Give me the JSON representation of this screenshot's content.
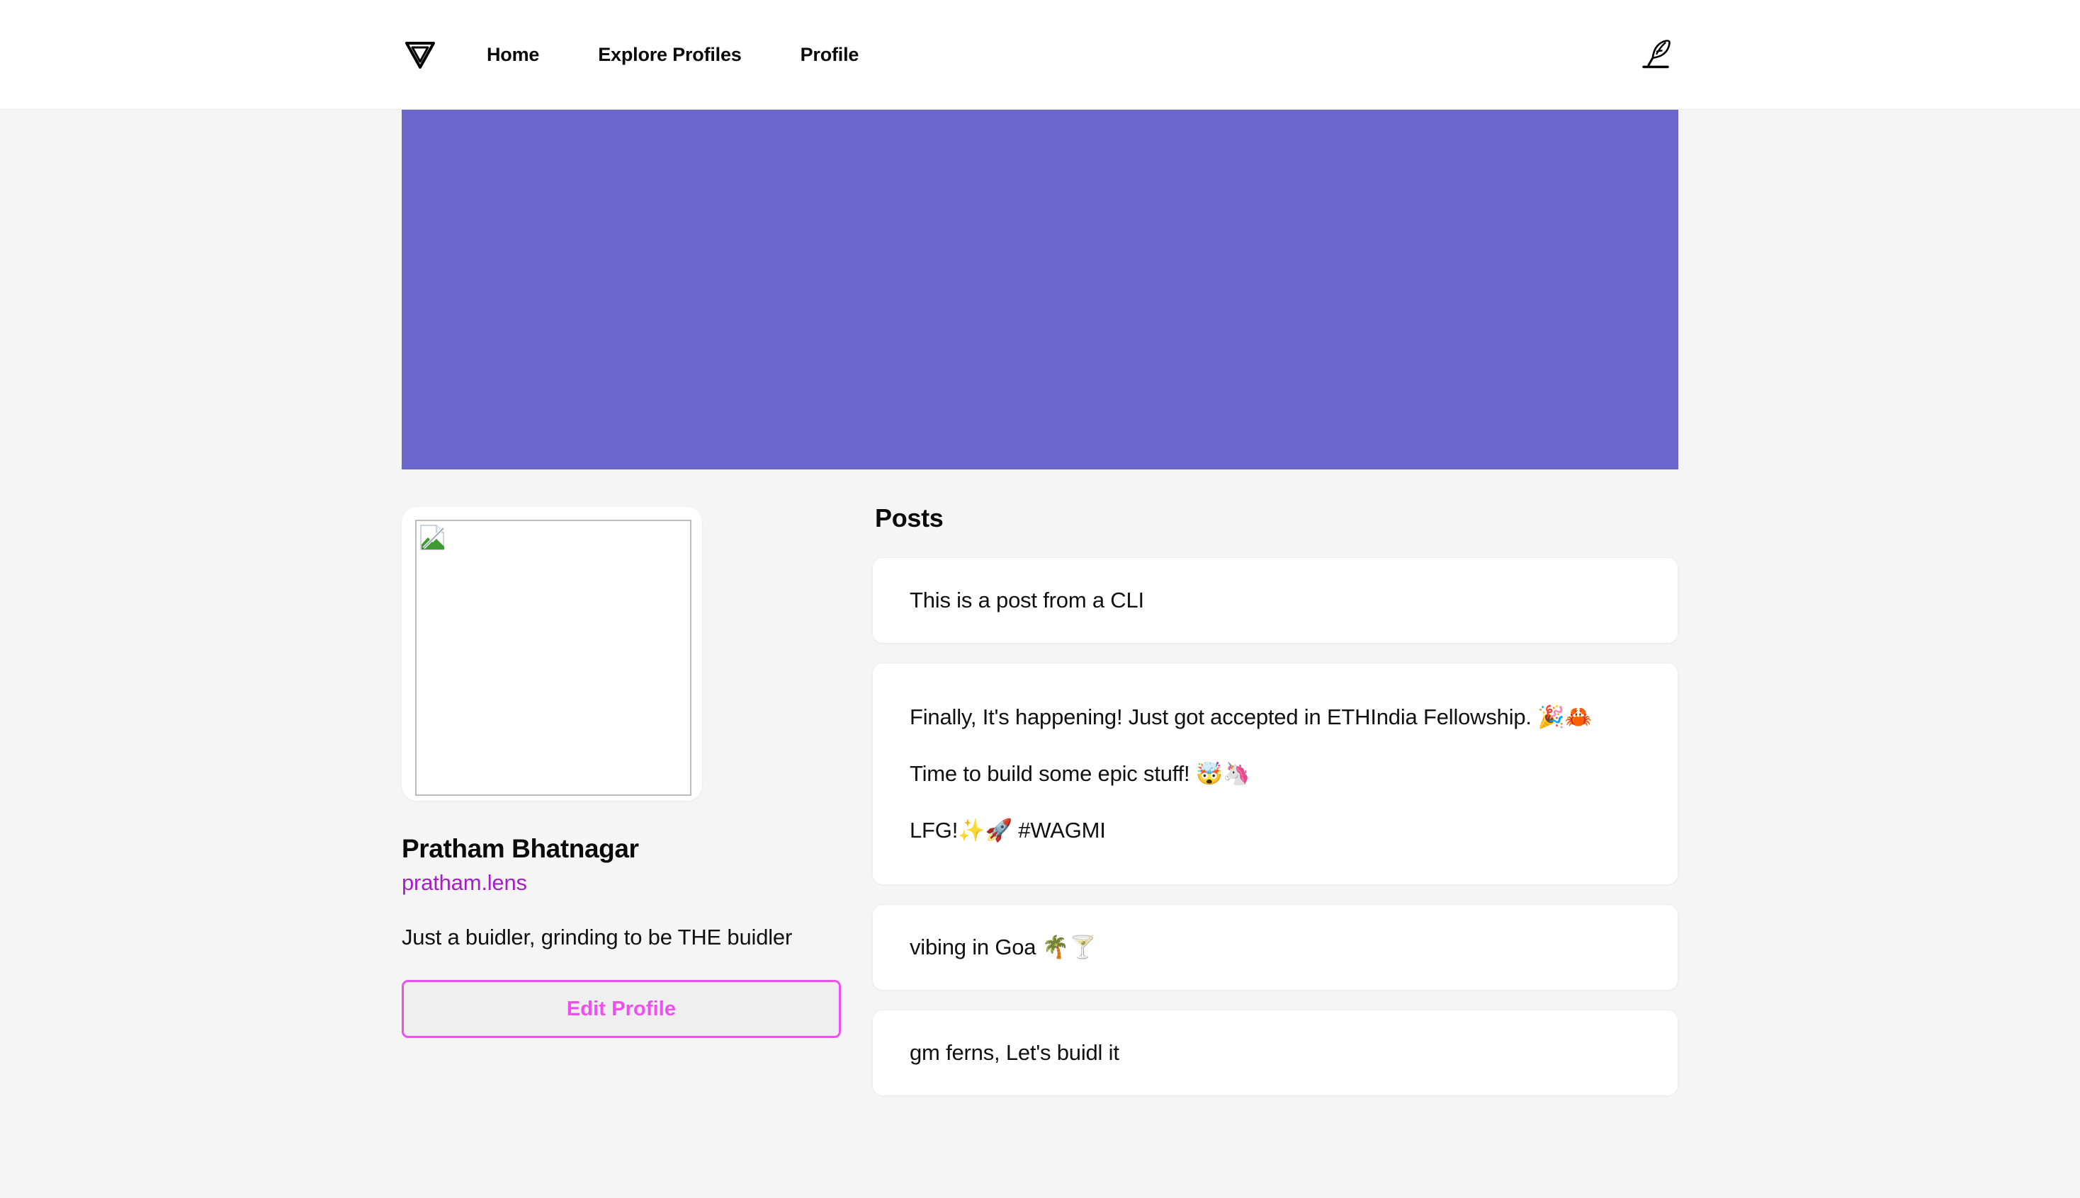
{
  "nav": {
    "logo_icon": "lens-triangle-logo",
    "links": [
      {
        "label": "Home"
      },
      {
        "label": "Explore Profiles"
      },
      {
        "label": "Profile"
      }
    ],
    "compose_icon": "quill-pen-icon"
  },
  "profile": {
    "cover_color": "#6a66cb",
    "avatar_alt": "",
    "avatar_state": "broken-image",
    "name": "Pratham Bhatnagar",
    "handle": "pratham.lens",
    "handle_color": "#a41fc4",
    "bio": "Just a buidler, grinding to be THE buidler",
    "edit_button_label": "Edit Profile",
    "edit_button_color": "#ee4fee"
  },
  "posts_section": {
    "heading": "Posts",
    "posts": [
      {
        "lines": [
          "This is a post from a CLI"
        ]
      },
      {
        "lines": [
          "Finally, It's happening! Just got accepted in ETHIndia Fellowship. 🎉🦀",
          "Time to build some epic stuff! 🤯🦄",
          "LFG!✨🚀 #WAGMI"
        ]
      },
      {
        "lines": [
          "vibing in Goa 🌴🍸"
        ]
      },
      {
        "lines": [
          "gm ferns, Let's buidl it"
        ]
      }
    ]
  }
}
